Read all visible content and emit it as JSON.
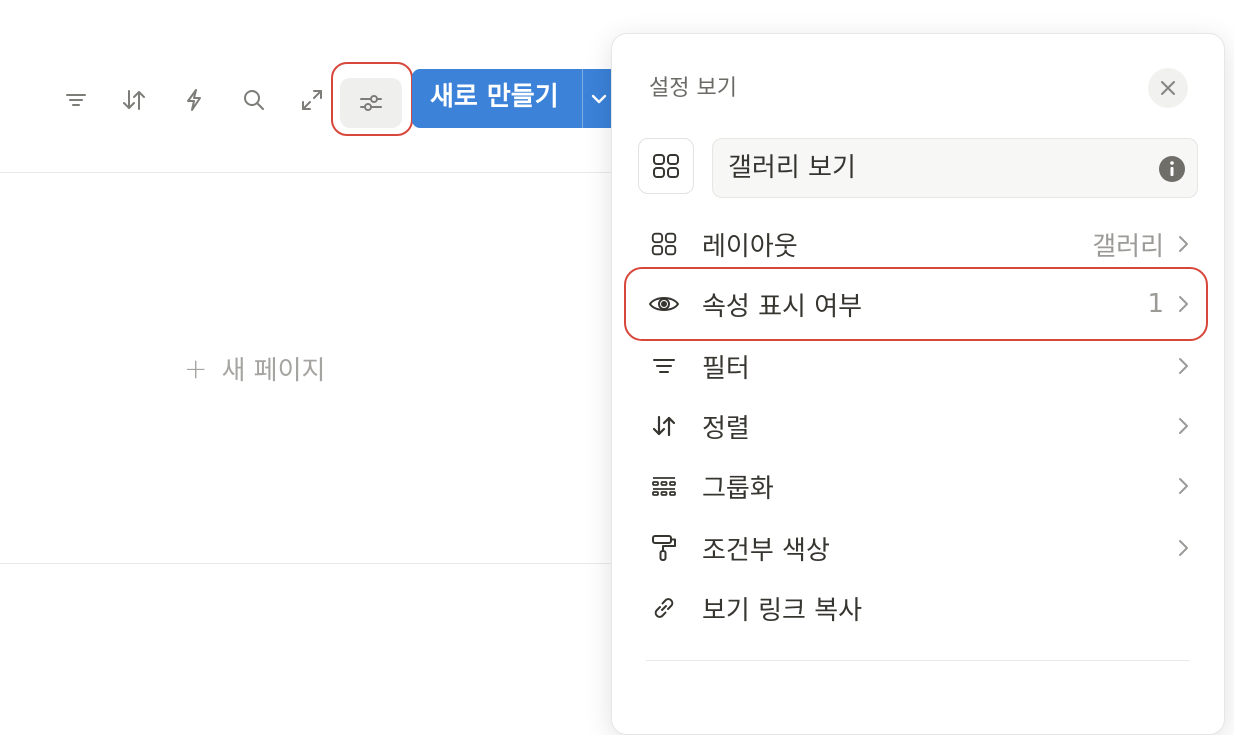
{
  "toolbar": {
    "icons": [
      "filter-icon",
      "sort-icon",
      "automation-bolt-icon",
      "search-icon",
      "expand-icon",
      "view-settings-icon"
    ],
    "new_button_label": "새로 만들기"
  },
  "board": {
    "new_page_label": "새 페이지"
  },
  "panel": {
    "title": "설정 보기",
    "view_name_value": "갤러리 보기",
    "menu": [
      {
        "icon": "layout-grid-icon",
        "label": "레이아웃",
        "value": "갤러리",
        "chevron": true
      },
      {
        "icon": "eye-icon",
        "label": "속성 표시 여부",
        "value": "1",
        "chevron": true
      },
      {
        "icon": "filter-icon",
        "label": "필터",
        "value": "",
        "chevron": true
      },
      {
        "icon": "sort-icon",
        "label": "정렬",
        "value": "",
        "chevron": true
      },
      {
        "icon": "group-icon",
        "label": "그룹화",
        "value": "",
        "chevron": true
      },
      {
        "icon": "paint-roller-icon",
        "label": "조건부 색상",
        "value": "",
        "chevron": true
      },
      {
        "icon": "link-icon",
        "label": "보기 링크 복사",
        "value": "",
        "chevron": false
      }
    ]
  },
  "colors": {
    "accent_blue": "#3b82d8",
    "highlight_red": "#d8473c",
    "muted_text": "#9b9a97"
  }
}
